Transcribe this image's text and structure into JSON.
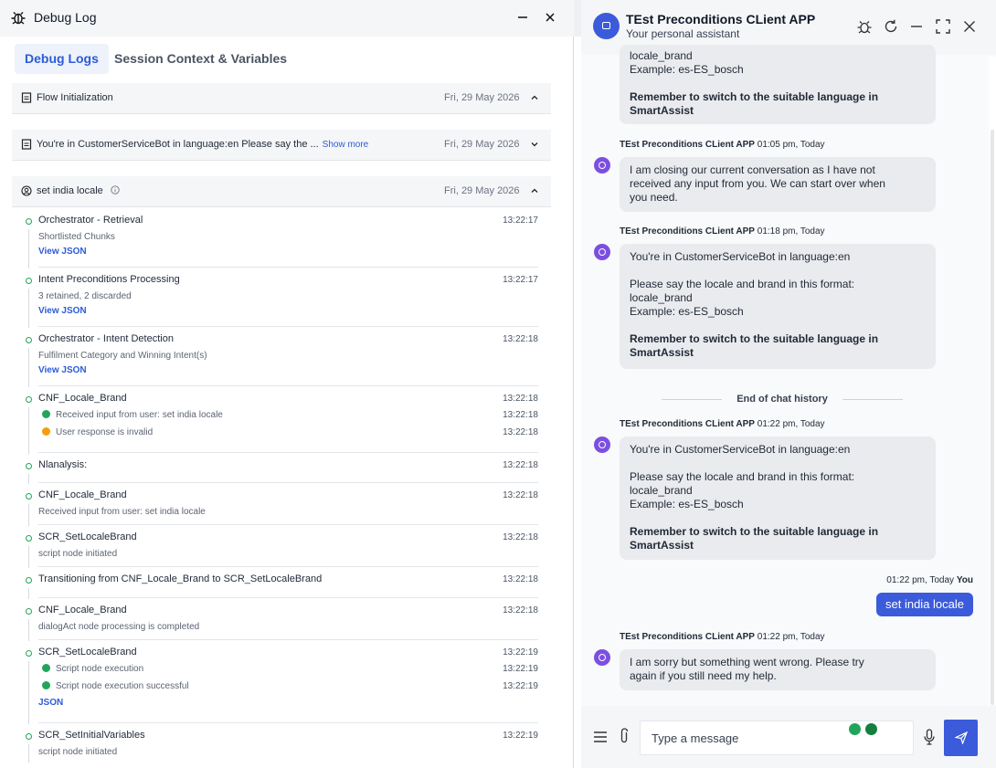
{
  "debug": {
    "title": "Debug Log",
    "tabs": [
      "Debug Logs",
      "Session Context & Variables"
    ],
    "sections": [
      {
        "title": "Flow Initialization",
        "date": "Fri, 29 May 2026",
        "expanded": true
      },
      {
        "title": "You're in CustomerServiceBot in language:en Please say the ...",
        "more": "Show more",
        "date": "Fri, 29 May 2026",
        "expanded": false
      },
      {
        "title": "set india locale",
        "date": "Fri, 29 May 2026",
        "expanded": true
      }
    ],
    "events": [
      {
        "title": "Orchestrator - Retrieval",
        "time": "13:22:17",
        "sub": "Shortlisted Chunks",
        "link": "View JSON"
      },
      {
        "title": "Intent Preconditions Processing",
        "time": "13:22:17",
        "sub": "3 retained, 2 discarded",
        "link": "View JSON"
      },
      {
        "title": "Orchestrator - Intent Detection",
        "time": "13:22:18",
        "sub": "Fulfilment Category and Winning Intent(s)",
        "link": "View JSON"
      },
      {
        "title": "CNF_Locale_Brand",
        "time": "13:22:18",
        "steps": [
          {
            "text": "Received input from user: set india locale",
            "time": "13:22:18",
            "status": "success"
          },
          {
            "text": "User response is invalid",
            "time": "13:22:18",
            "status": "warning"
          }
        ]
      },
      {
        "title": "Nlanalysis:",
        "time": "13:22:18"
      },
      {
        "title": "CNF_Locale_Brand",
        "time": "13:22:18",
        "sub": "Received input from user: set india locale"
      },
      {
        "title": "SCR_SetLocaleBrand",
        "time": "13:22:18",
        "sub": "script node initiated"
      },
      {
        "title": "Transitioning from CNF_Locale_Brand to SCR_SetLocaleBrand",
        "time": "13:22:18"
      },
      {
        "title": "CNF_Locale_Brand",
        "time": "13:22:18",
        "sub": "dialogAct node processing is completed"
      },
      {
        "title": "SCR_SetLocaleBrand",
        "time": "13:22:19",
        "steps": [
          {
            "text": "Script node execution",
            "time": "13:22:19",
            "status": "success"
          },
          {
            "text": "Script node execution successful",
            "time": "13:22:19",
            "status": "success"
          }
        ],
        "link": "JSON"
      },
      {
        "title": "SCR_SetInitialVariables",
        "time": "13:22:19",
        "sub": "script node initiated"
      }
    ]
  },
  "chat": {
    "app_title": "TEst Preconditions CLient APP",
    "app_subtitle": "Your personal assistant",
    "messages": [
      {
        "lines": [
          "locale_brand",
          "Example: es-ES_bosch"
        ],
        "bold": [
          "Remember to switch to the suitable language in",
          "SmartAssist"
        ]
      },
      {
        "sender": "TEst Preconditions CLient APP",
        "time": "01:05 pm, Today",
        "lines": [
          "I am closing our current conversation as I have not",
          "received any input from you. We can start over when",
          "you need."
        ]
      },
      {
        "sender": "TEst Preconditions CLient APP",
        "time": "01:18 pm, Today",
        "lines": [
          "You're in CustomerServiceBot in language:en",
          "",
          "Please say the locale and brand in this format:",
          "locale_brand",
          "Example: es-ES_bosch"
        ],
        "bold": [
          "Remember to switch to the suitable language in",
          "SmartAssist"
        ]
      },
      {
        "sender": "TEst Preconditions CLient APP",
        "time": "01:22 pm, Today",
        "lines": [
          "You're in CustomerServiceBot in language:en",
          "",
          "Please say the locale and brand in this format:",
          "locale_brand",
          "Example: es-ES_bosch"
        ],
        "bold": [
          "Remember to switch to the suitable language in",
          "SmartAssist"
        ]
      },
      {
        "sender": "TEst Preconditions CLient APP",
        "time": "01:22 pm, Today",
        "lines": [
          "I am sorry but something went wrong. Please try",
          "again if you still need my help."
        ]
      }
    ],
    "divider": "End of chat history",
    "user_message": {
      "time": "01:22 pm, Today",
      "sender": "You",
      "text": "set india locale"
    },
    "input_placeholder": "Type a message"
  }
}
